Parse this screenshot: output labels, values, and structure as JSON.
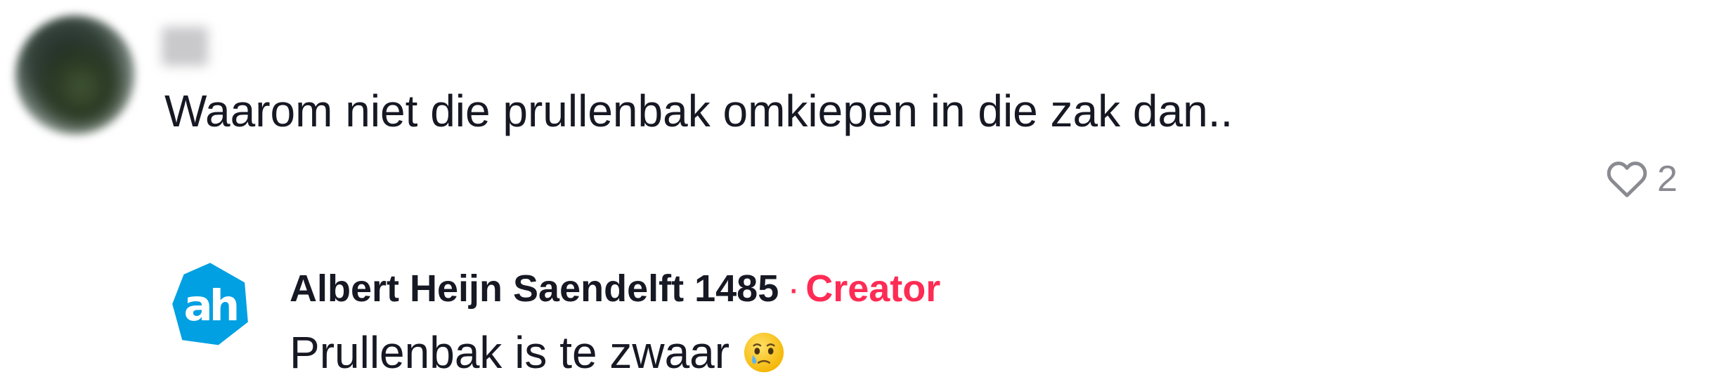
{
  "comment": {
    "username": "",
    "text": "Waarom niet die prullenbak omkiepen in die zak dan..",
    "like_count": "2",
    "like_icon": "heart-outline-icon"
  },
  "reply": {
    "author": "Albert Heijn Saendelft 1485",
    "separator": "·",
    "badge": "Creator",
    "text": "Prullenbak is te zwaar",
    "emoji_icon": "face-holding-back-tears-icon",
    "avatar_icon": "ah-logo-icon"
  },
  "colors": {
    "text": "#161823",
    "muted": "#8a8b91",
    "creator_badge": "#fe2c55",
    "ah_brand": "#00a0e2"
  }
}
